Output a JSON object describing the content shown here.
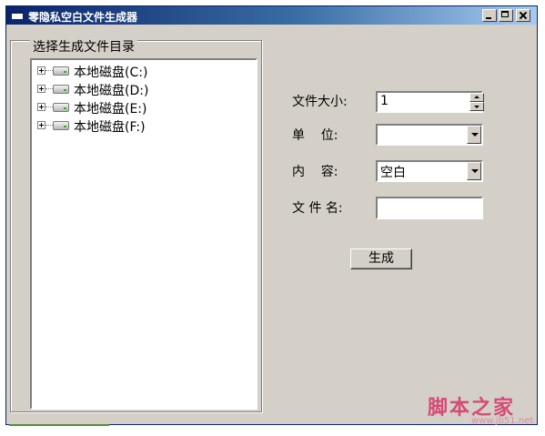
{
  "window": {
    "title": "零隐私空白文件生成器"
  },
  "group": {
    "title": "选择生成文件目录"
  },
  "tree": {
    "items": [
      {
        "label": "本地磁盘(C:)"
      },
      {
        "label": "本地磁盘(D:)"
      },
      {
        "label": "本地磁盘(E:)"
      },
      {
        "label": "本地磁盘(F:)"
      }
    ]
  },
  "form": {
    "size_label": "文件大小:",
    "size_value": "1",
    "unit_label": "单    位:",
    "unit_value": "",
    "content_label": "内    容:",
    "content_value": "空白",
    "filename_label": "文 件 名:",
    "filename_value": ""
  },
  "actions": {
    "generate_label": "生成"
  },
  "watermark": {
    "text": "脚本之家",
    "url": "www.jb51.net"
  }
}
